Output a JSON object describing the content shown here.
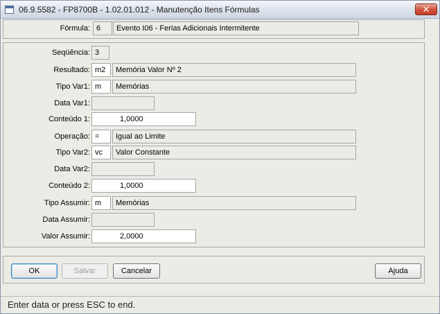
{
  "window": {
    "title": "06.9.5582 - FP8700B - 1.02.01.012 - Manutenção Itens Fórmulas",
    "close_glyph": "✕"
  },
  "formula": {
    "label": "Fórmula:",
    "code": "6",
    "description": "Evento I06 - Ferias Adicionais Intermitente"
  },
  "fields": {
    "sequencia": {
      "label": "Seqüência:",
      "value": "3"
    },
    "resultado": {
      "label": "Resultado:",
      "code": "m2",
      "description": "Memória Valor Nº 2"
    },
    "tipo_var1": {
      "label": "Tipo Var1:",
      "code": "m",
      "description": "Memórias"
    },
    "data_var1": {
      "label": "Data Var1:",
      "value": ""
    },
    "conteudo1": {
      "label": "Conteúdo 1:",
      "value": "1,0000"
    },
    "operacao": {
      "label": "Operação:",
      "code": "=",
      "description": "Igual ao Limite"
    },
    "tipo_var2": {
      "label": "Tipo Var2:",
      "code": "vc",
      "description": "Valor Constante"
    },
    "data_var2": {
      "label": "Data Var2:",
      "value": ""
    },
    "conteudo2": {
      "label": "Conteúdo 2:",
      "value": "1,0000"
    },
    "tipo_assumir": {
      "label": "Tipo Assumir:",
      "code": "m",
      "description": "Memórias"
    },
    "data_assumir": {
      "label": "Data Assumir:",
      "value": ""
    },
    "valor_assumir": {
      "label": "Valor Assumir:",
      "value": "2,0000"
    }
  },
  "buttons": {
    "ok": "OK",
    "salvar": "Salvar",
    "cancelar": "Cancelar",
    "ajuda": "Ajuda"
  },
  "status_bar": "Enter data or press ESC to end."
}
